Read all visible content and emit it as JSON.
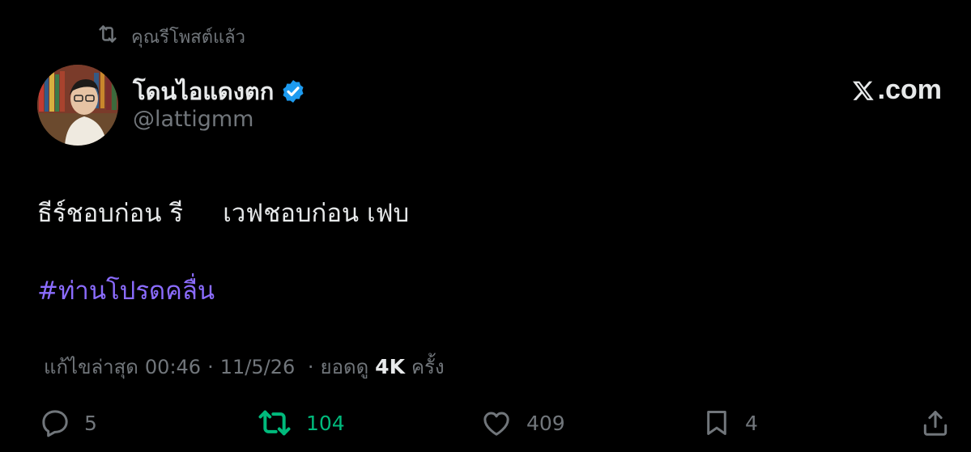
{
  "header": {
    "repost_label": "คุณรีโพสต์แล้ว"
  },
  "author": {
    "display_name": "โดนไอแดงตก",
    "handle": "@lattigmm",
    "verified": true
  },
  "brand": {
    "site_label": ".com"
  },
  "tweet": {
    "text": "ธีร์ชอบก่อน รี     เวฟชอบก่อน เฟบ",
    "hashtag": "#ท่านโปรดคลื่น"
  },
  "meta": {
    "edited_label": "แก้ไขล่าสุด",
    "time": "00:46",
    "date": "11/5/26",
    "views_label": "ยอดดู",
    "views_count": "4K",
    "views_suffix": "ครั้ง"
  },
  "actions": {
    "replies": "5",
    "reposts": "104",
    "likes": "409",
    "bookmarks": "4"
  },
  "colors": {
    "background": "#000000",
    "text": "#e7e9ea",
    "muted": "#71767b",
    "hashtag": "#8b6cff",
    "retweet_active": "#00ba7c",
    "verified": "#1d9bf0"
  },
  "icons": [
    "repost-icon",
    "verified-badge-icon",
    "x-logo-icon",
    "reply-icon",
    "retweet-icon",
    "like-icon",
    "bookmark-icon",
    "share-icon"
  ]
}
